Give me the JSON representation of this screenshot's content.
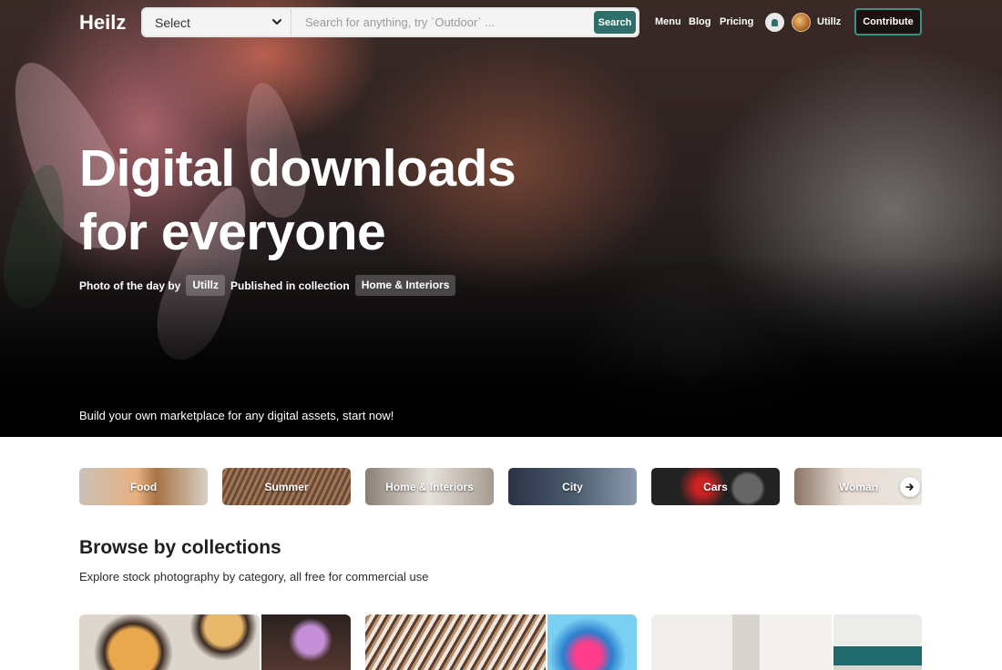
{
  "nav": {
    "logo": "Heilz",
    "select_label": "Select",
    "search_placeholder": "Search for anything, try `Outdoor` ...",
    "search_button": "Search",
    "links": [
      "Menu",
      "Blog",
      "Pricing"
    ],
    "user_name": "Utillz",
    "contribute_label": "Contribute"
  },
  "hero": {
    "headline_line1": "Digital downloads",
    "headline_line2": "for everyone",
    "credit_prefix": "Photo of the day by",
    "credit_author": "Utillz",
    "credit_middle": "Published in collection",
    "credit_collection": "Home & Interiors",
    "tagline": "Build your own marketplace for any digital assets, start now!"
  },
  "categories": [
    "Food",
    "Summer",
    "Home & Interiors",
    "City",
    "Cars",
    "Woman"
  ],
  "browse": {
    "title": "Browse by collections",
    "subtitle": "Explore stock photography by category, all free for commercial use"
  },
  "icons": {
    "dropdown": "chevron-down-icon",
    "notifications": "bell-icon",
    "carousel_next": "arrow-right-icon"
  },
  "colors": {
    "accent": "#2f6f6a",
    "contribute_border": "#3f8f86"
  }
}
